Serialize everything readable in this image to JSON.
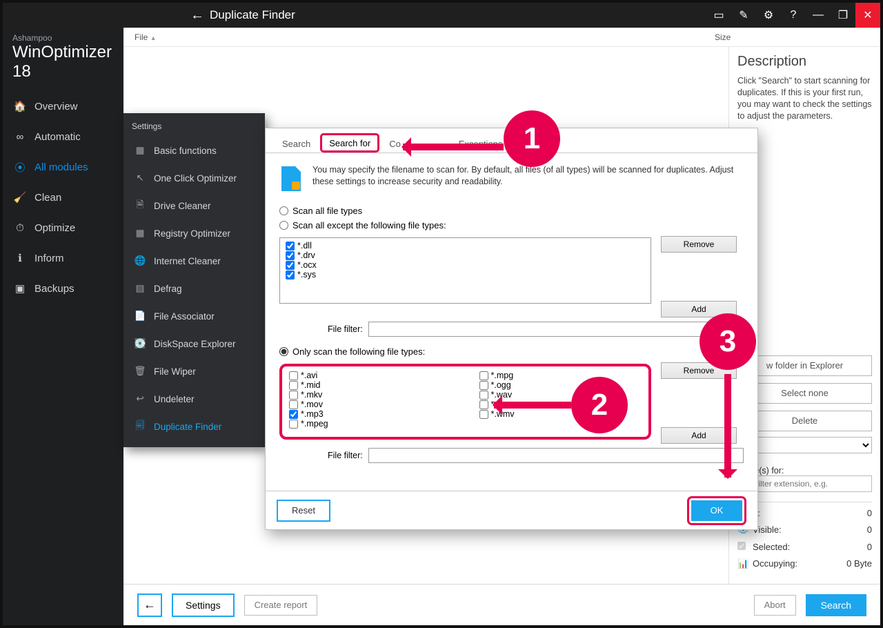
{
  "brand": {
    "small": "Ashampoo",
    "big_a": "WinOptimizer ",
    "big_b": "18"
  },
  "titlebar": {
    "title": "Duplicate Finder"
  },
  "nav": {
    "overview": "Overview",
    "automatic": "Automatic",
    "allmodules": "All modules",
    "clean": "Clean",
    "optimize": "Optimize",
    "inform": "Inform",
    "backups": "Backups"
  },
  "listhdr": {
    "file": "File",
    "size": "Size",
    "sort": "▲"
  },
  "flyout": {
    "header": "Settings",
    "items": {
      "basic": "Basic functions",
      "oneclick": "One Click Optimizer",
      "drive": "Drive Cleaner",
      "registry": "Registry Optimizer",
      "internet": "Internet Cleaner",
      "defrag": "Defrag",
      "fileassoc": "File Associator",
      "diskspace": "DiskSpace Explorer",
      "filewiper": "File Wiper",
      "undeleter": "Undeleter",
      "dup": "Duplicate Finder"
    }
  },
  "dialog": {
    "tabs": {
      "search": "Search",
      "searchfor": "Search for",
      "comparison": "Co",
      "exceptions": "Exceptions"
    },
    "info": "You may specify the filename to scan for. By default, all files (of all types) will be scanned for duplicates. Adjust these settings to increase security and readability.",
    "radio_all": "Scan all file types",
    "radio_except": "Scan all except the following file types:",
    "except_list": [
      "*.dll",
      "*.drv",
      "*.ocx",
      "*.sys"
    ],
    "radio_only": "Only scan the following file types:",
    "only_list_l": [
      "*.avi",
      "*.mid",
      "*.mkv",
      "*.mov",
      "*.mp3",
      "*.mpeg"
    ],
    "only_list_r": [
      "*.mpg",
      "*.ogg",
      "*.wav",
      "*.wma",
      "*.wmv"
    ],
    "only_checked": "*.mp3",
    "filter_label": "File filter:",
    "remove": "Remove",
    "add": "Add",
    "reset": "Reset",
    "ok": "OK"
  },
  "right": {
    "title": "Description",
    "desc": "Click \"Search\" to start scanning for duplicates. If this is your first run, you may want to check the settings to adjust the parameters.",
    "openfolder": "w folder in Explorer",
    "selectnone": "Select none",
    "delete": "Delete",
    "newnames": "name(s) for:",
    "placeholder": "e a filter extension, e.g.",
    "stats": {
      "d": "d:",
      "visible": "Visible:",
      "selected": "Selected:",
      "occupying": "Occupying:",
      "v_d": "0",
      "v_visible": "0",
      "v_selected": "0",
      "v_occupying": "0 Byte"
    }
  },
  "bottombar": {
    "settings": "Settings",
    "createreport": "Create report",
    "abort": "Abort",
    "search": "Search"
  },
  "bubbles": {
    "1": "1",
    "2": "2",
    "3": "3"
  }
}
